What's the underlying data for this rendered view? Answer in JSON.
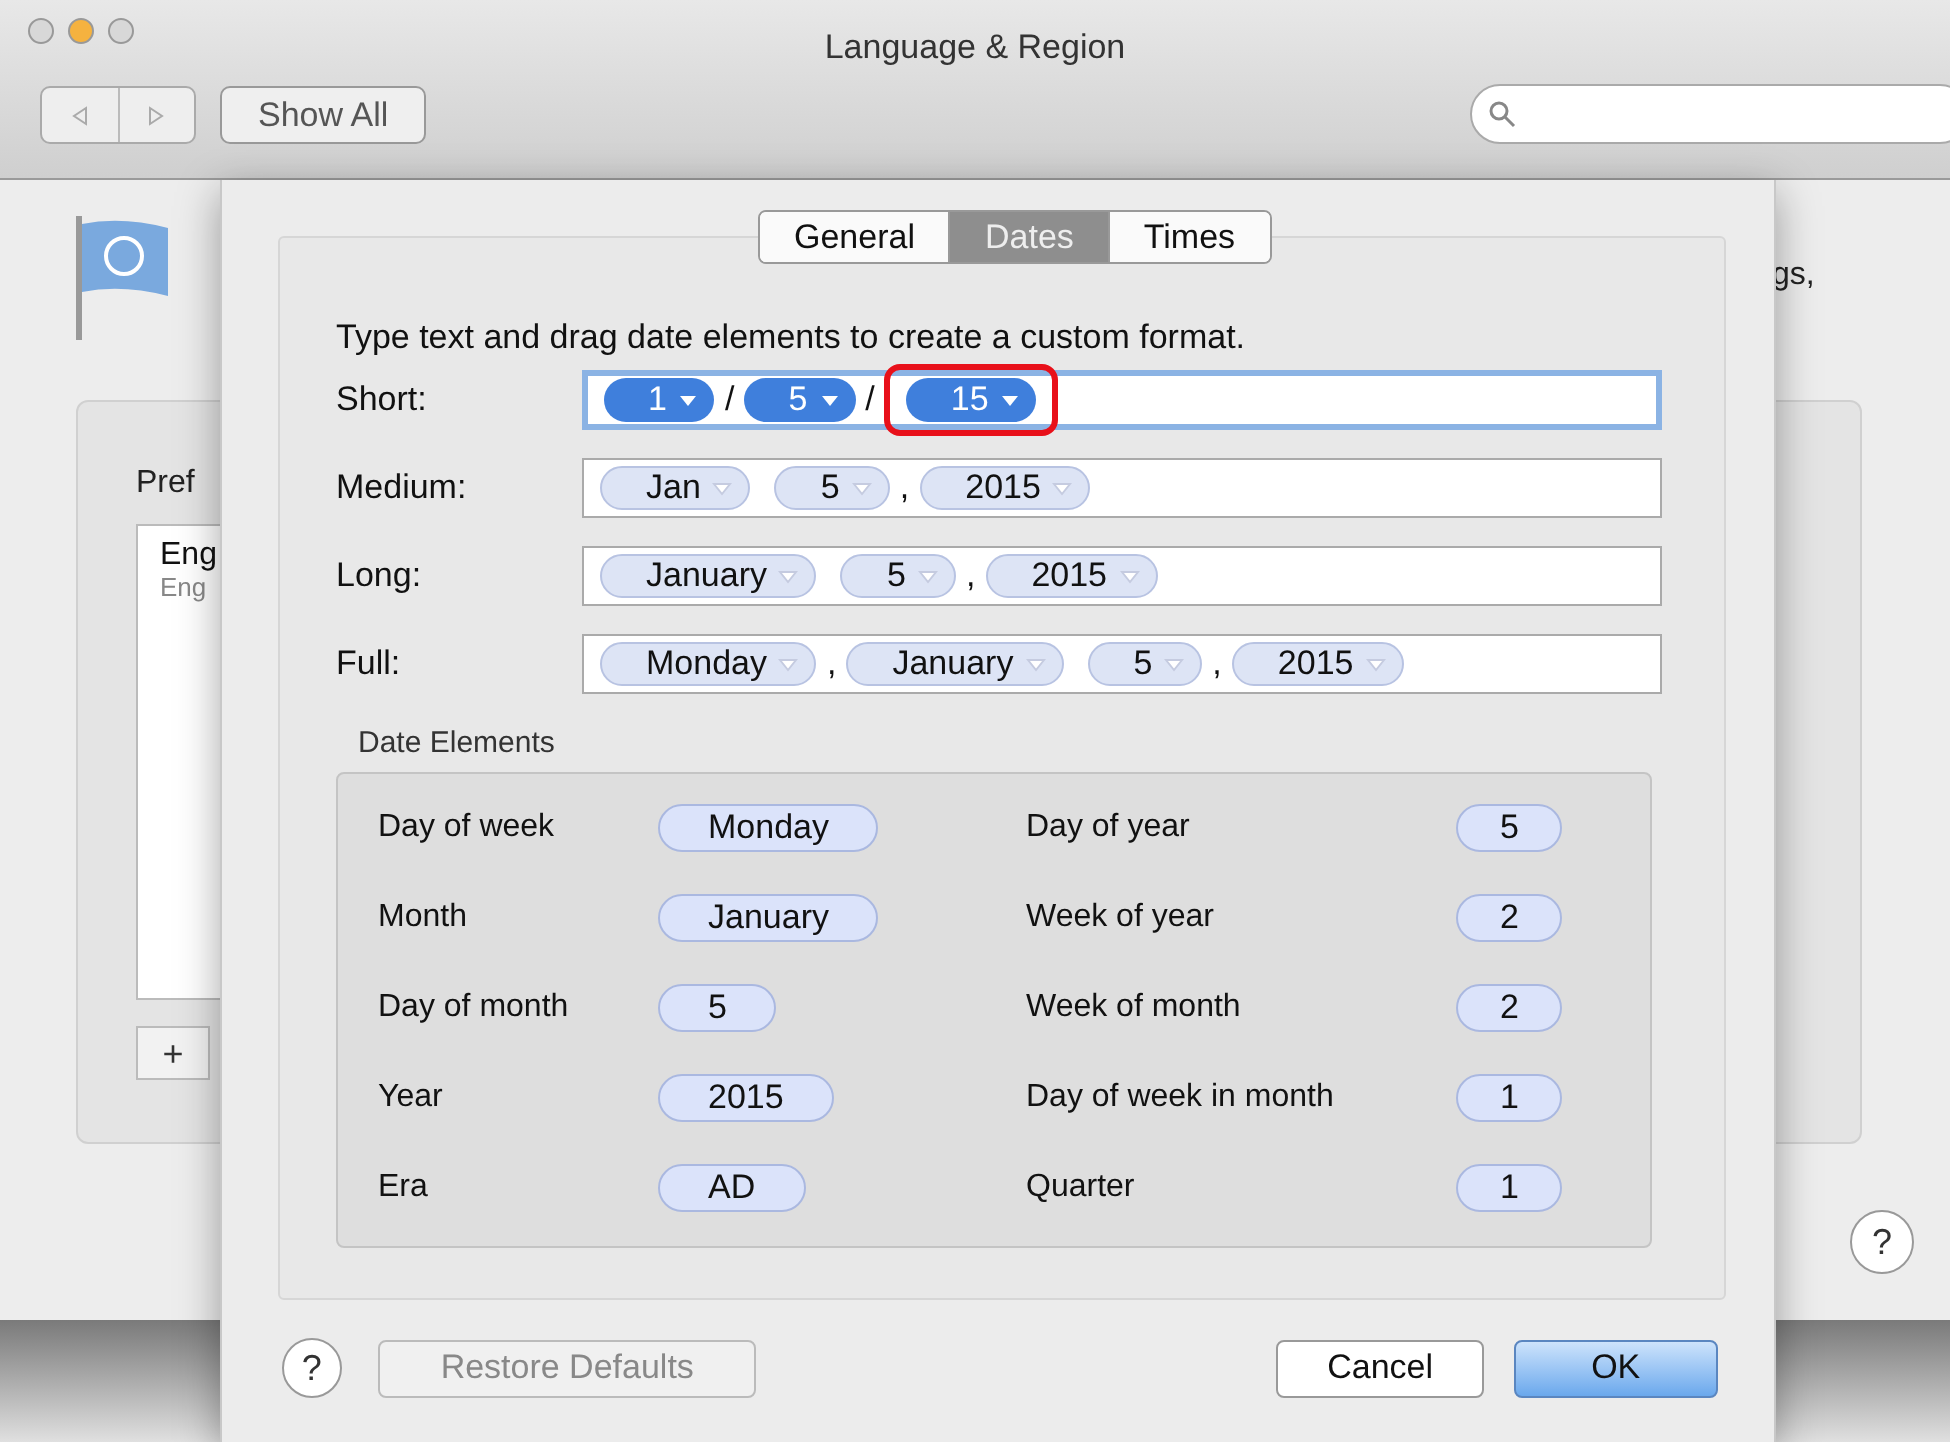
{
  "window": {
    "title": "Language & Region"
  },
  "toolbar": {
    "show_all": "Show All"
  },
  "background": {
    "intro_fragment": "gs,",
    "preferred_label_fragment": "Pref",
    "languages": [
      {
        "name": "Eng",
        "detail": "Eng"
      }
    ],
    "add_button": "+",
    "help_button": "?"
  },
  "sheet": {
    "tabs": [
      {
        "label": "General",
        "selected": false
      },
      {
        "label": "Dates",
        "selected": true
      },
      {
        "label": "Times",
        "selected": false
      }
    ],
    "instruction": "Type text and drag date elements to create a custom format.",
    "formats": [
      {
        "label": "Short:",
        "focused": true,
        "parts": [
          {
            "kind": "token",
            "text": "1",
            "selected": true
          },
          {
            "kind": "sep",
            "text": "/"
          },
          {
            "kind": "token",
            "text": "5",
            "selected": true
          },
          {
            "kind": "sep",
            "text": "/"
          },
          {
            "kind": "token",
            "text": "15",
            "selected": true,
            "highlighted": true
          }
        ]
      },
      {
        "label": "Medium:",
        "focused": false,
        "parts": [
          {
            "kind": "token",
            "text": "Jan",
            "selected": false
          },
          {
            "kind": "token",
            "text": "5",
            "selected": false
          },
          {
            "kind": "sep",
            "text": ","
          },
          {
            "kind": "token",
            "text": "2015",
            "selected": false
          }
        ]
      },
      {
        "label": "Long:",
        "focused": false,
        "parts": [
          {
            "kind": "token",
            "text": "January",
            "selected": false
          },
          {
            "kind": "token",
            "text": "5",
            "selected": false
          },
          {
            "kind": "sep",
            "text": ","
          },
          {
            "kind": "token",
            "text": "2015",
            "selected": false
          }
        ]
      },
      {
        "label": "Full:",
        "focused": false,
        "parts": [
          {
            "kind": "token",
            "text": "Monday",
            "selected": false
          },
          {
            "kind": "sep",
            "text": ","
          },
          {
            "kind": "token",
            "text": "January",
            "selected": false
          },
          {
            "kind": "token",
            "text": "5",
            "selected": false
          },
          {
            "kind": "sep",
            "text": ","
          },
          {
            "kind": "token",
            "text": "2015",
            "selected": false
          }
        ]
      }
    ],
    "date_elements": {
      "title": "Date Elements",
      "items": [
        {
          "label": "Day of week",
          "token": "Monday"
        },
        {
          "label": "Day of year",
          "token": "5"
        },
        {
          "label": "Month",
          "token": "January"
        },
        {
          "label": "Week of year",
          "token": "2"
        },
        {
          "label": "Day of month",
          "token": "5"
        },
        {
          "label": "Week of month",
          "token": "2"
        },
        {
          "label": "Year",
          "token": "2015"
        },
        {
          "label": "Day of week in month",
          "token": "1"
        },
        {
          "label": "Era",
          "token": "AD"
        },
        {
          "label": "Quarter",
          "token": "1"
        }
      ]
    },
    "help_button": "?",
    "restore_button": {
      "label": "Restore Defaults",
      "disabled": true
    },
    "cancel_button": "Cancel",
    "ok_button": {
      "label": "OK",
      "default": true
    }
  }
}
